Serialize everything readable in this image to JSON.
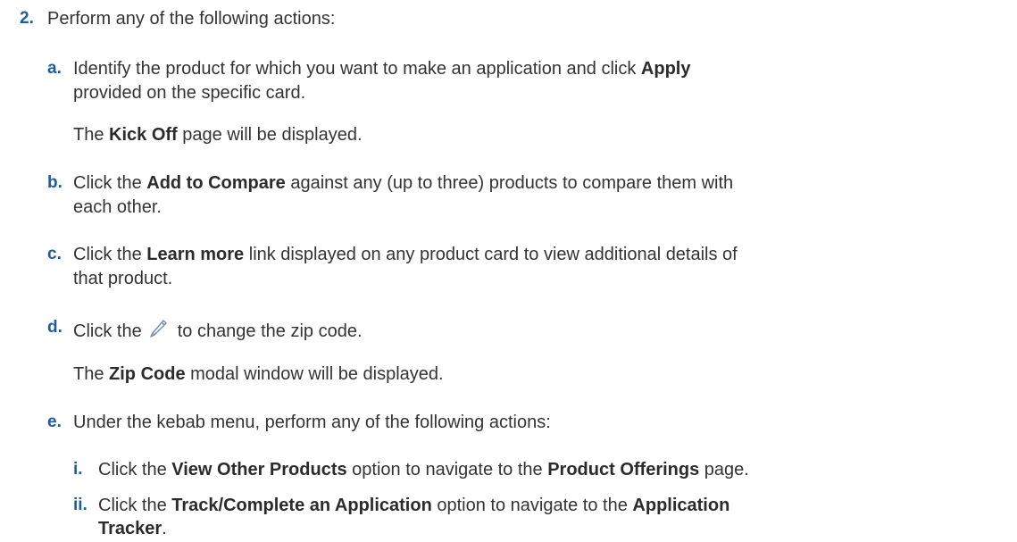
{
  "step": {
    "number": "2.",
    "text": "Perform any of the following actions:"
  },
  "substeps": [
    {
      "marker": "a.",
      "lines": [
        [
          {
            "t": "Identify the product for which you want to make an application and click "
          },
          {
            "t": "Apply",
            "b": true
          }
        ],
        [
          {
            "t": "provided on the specific card."
          }
        ]
      ],
      "result": [
        {
          "t": "The "
        },
        {
          "t": "Kick Off",
          "b": true
        },
        {
          "t": " page will be displayed."
        }
      ]
    },
    {
      "marker": "b.",
      "lines": [
        [
          {
            "t": "Click the "
          },
          {
            "t": "Add to Compare",
            "b": true
          },
          {
            "t": " against any (up to three) products to compare them with"
          }
        ],
        [
          {
            "t": "each other."
          }
        ]
      ]
    },
    {
      "marker": "c.",
      "lines": [
        [
          {
            "t": "Click the "
          },
          {
            "t": "Learn more",
            "b": true
          },
          {
            "t": " link displayed on any product card to view additional details of"
          }
        ],
        [
          {
            "t": "that product."
          }
        ]
      ]
    },
    {
      "marker": "d.",
      "before_icon": "Click the",
      "icon": "pencil-edit-icon",
      "after_icon": "to change the zip code.",
      "result": [
        {
          "t": "The "
        },
        {
          "t": "Zip Code",
          "b": true
        },
        {
          "t": " modal window will be displayed."
        }
      ]
    },
    {
      "marker": "e.",
      "lines": [
        [
          {
            "t": "Under the kebab menu, perform any of the following actions:"
          }
        ]
      ],
      "children": [
        {
          "marker": "i.",
          "lines": [
            [
              {
                "t": "Click the "
              },
              {
                "t": "View Other Products",
                "b": true
              },
              {
                "t": " option to navigate to the "
              },
              {
                "t": "Product Offerings",
                "b": true
              },
              {
                "t": " page."
              }
            ]
          ]
        },
        {
          "marker": "ii.",
          "lines": [
            [
              {
                "t": "Click the "
              },
              {
                "t": "Track/Complete an Application",
                "b": true
              },
              {
                "t": " option to navigate to the "
              },
              {
                "t": "Application",
                "b": true
              }
            ],
            [
              {
                "t": "Tracker",
                "b": true
              },
              {
                "t": "."
              }
            ]
          ]
        }
      ]
    }
  ],
  "colors": {
    "marker": "#1f5c9e",
    "text": "#333333",
    "icon": "#7a8fa8"
  }
}
